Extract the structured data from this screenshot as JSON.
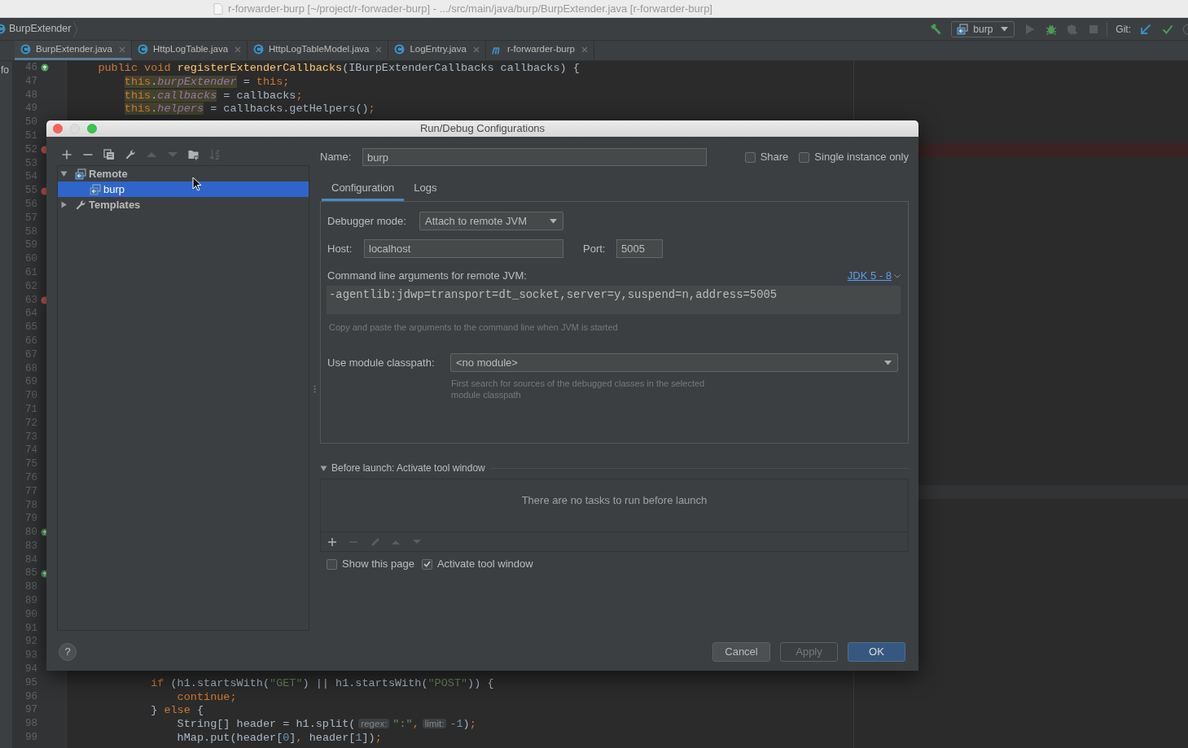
{
  "window": {
    "title": "r-forwarder-burp [~/project/r-forwader-burp] - .../src/main/java/burp/BurpExtender.java [r-forwarder-burp]"
  },
  "navigation_bar": {
    "breadcrumb": "BurpExtender",
    "run_configuration": "burp",
    "git_label": "Git:"
  },
  "editor_tabs": [
    {
      "label": "BurpExtender.java",
      "kind": "class",
      "selected": true
    },
    {
      "label": "HttpLogTable.java",
      "kind": "class",
      "selected": false
    },
    {
      "label": "HttpLogTableModel.java",
      "kind": "class",
      "selected": false
    },
    {
      "label": "LogEntry.java",
      "kind": "class",
      "selected": false
    },
    {
      "label": "r-forwarder-burp",
      "kind": "module",
      "selected": false
    }
  ],
  "side_strip": {
    "label": "fo"
  },
  "editor": {
    "lines": [
      {
        "number": "46",
        "kind": "override",
        "tokens": [
          {
            "text": "    public void ",
            "kind": "keyword"
          },
          {
            "text": "registerExtenderCallbacks",
            "kind": "method"
          },
          {
            "text": "(IBurpExtenderCallbacks callbacks) {"
          }
        ]
      },
      {
        "number": "47",
        "kind": "plain",
        "tokens": [
          {
            "text": "        this",
            "kind": "keyword",
            "highlighted": true
          },
          {
            "text": ".",
            "highlighted": true
          },
          {
            "text": "burpExtender",
            "kind": "field",
            "highlighted": true
          },
          {
            "text": " = "
          },
          {
            "text": "this;",
            "kind": "keyword"
          }
        ]
      },
      {
        "number": "48",
        "kind": "plain",
        "tokens": [
          {
            "text": "        this",
            "kind": "keyword",
            "highlighted": true
          },
          {
            "text": ".",
            "highlighted": true
          },
          {
            "text": "callbacks",
            "kind": "field",
            "highlighted": true
          },
          {
            "text": " = callbacks"
          },
          {
            "text": ";",
            "kind": "keyword"
          }
        ]
      },
      {
        "number": "49",
        "kind": "plain",
        "tokens": [
          {
            "text": "        this",
            "kind": "keyword",
            "highlighted": true
          },
          {
            "text": ".",
            "highlighted": true
          },
          {
            "text": "helpers",
            "kind": "field",
            "highlighted": true
          },
          {
            "text": " = callbacks.getHelpers()"
          },
          {
            "text": ";",
            "kind": "keyword"
          }
        ]
      },
      {
        "number": "50",
        "kind": "plain"
      },
      {
        "number": "51",
        "kind": "plain"
      },
      {
        "number": "52",
        "kind": "breakpoint",
        "error": true
      },
      {
        "number": "53",
        "kind": "plain"
      },
      {
        "number": "54",
        "kind": "plain"
      },
      {
        "number": "55",
        "kind": "breakpoint"
      },
      {
        "number": "56",
        "kind": "plain"
      },
      {
        "number": "57",
        "kind": "plain"
      },
      {
        "number": "58",
        "kind": "plain"
      },
      {
        "number": "59",
        "kind": "plain"
      },
      {
        "number": "60",
        "kind": "plain"
      },
      {
        "number": "61",
        "kind": "plain"
      },
      {
        "number": "62",
        "kind": "plain"
      },
      {
        "number": "63",
        "kind": "breakpoint"
      },
      {
        "number": "64",
        "kind": "plain"
      },
      {
        "number": "65",
        "kind": "plain"
      },
      {
        "number": "66",
        "kind": "plain"
      },
      {
        "number": "67",
        "kind": "plain"
      },
      {
        "number": "68",
        "kind": "plain"
      },
      {
        "number": "69",
        "kind": "plain"
      },
      {
        "number": "70",
        "kind": "plain"
      },
      {
        "number": "71",
        "kind": "plain"
      },
      {
        "number": "72",
        "kind": "plain"
      },
      {
        "number": "73",
        "kind": "plain"
      },
      {
        "number": "74",
        "kind": "plain"
      },
      {
        "number": "75",
        "kind": "plain"
      },
      {
        "number": "76",
        "kind": "plain"
      },
      {
        "number": "77",
        "kind": "plain",
        "highlighted": true
      },
      {
        "number": "78",
        "kind": "plain"
      },
      {
        "number": "79",
        "kind": "plain"
      },
      {
        "number": "80",
        "kind": "override"
      },
      {
        "number": "83",
        "kind": "plain"
      },
      {
        "number": "84",
        "kind": "plain"
      },
      {
        "number": "85",
        "kind": "override"
      },
      {
        "number": "88",
        "kind": "plain"
      },
      {
        "number": "89",
        "kind": "plain"
      },
      {
        "number": "90",
        "kind": "plain"
      },
      {
        "number": "91",
        "kind": "plain"
      },
      {
        "number": "92",
        "kind": "plain"
      },
      {
        "number": "93",
        "kind": "plain"
      },
      {
        "number": "94",
        "kind": "plain"
      },
      {
        "number": "95",
        "kind": "plain",
        "tokens": [
          {
            "text": "            if",
            "kind": "keyword"
          },
          {
            "text": " (h1.startsWith("
          },
          {
            "text": "\"GET\"",
            "kind": "string"
          },
          {
            "text": ") || h1.startsWith("
          },
          {
            "text": "\"POST\"",
            "kind": "string"
          },
          {
            "text": ")) {"
          }
        ]
      },
      {
        "number": "96",
        "kind": "plain",
        "tokens": [
          {
            "text": "                continue;",
            "kind": "keyword"
          }
        ]
      },
      {
        "number": "97",
        "kind": "plain",
        "tokens": [
          {
            "text": "            } "
          },
          {
            "text": "else",
            "kind": "keyword"
          },
          {
            "text": " {"
          }
        ]
      },
      {
        "number": "98",
        "kind": "plain",
        "tokens": [
          {
            "text": "                String[] header = h1.split("
          },
          {
            "text": "regex:",
            "kind": "hint"
          },
          {
            "text": "\":\"",
            "kind": "string"
          },
          {
            "text": ",",
            "kind": "keyword"
          },
          {
            "text": "limit:",
            "kind": "hint"
          },
          {
            "text": "-1",
            "kind": "number"
          },
          {
            "text": ")"
          },
          {
            "text": ";",
            "kind": "keyword"
          }
        ]
      },
      {
        "number": "99",
        "kind": "plain",
        "tokens": [
          {
            "text": "                hMap.put(header["
          },
          {
            "text": "0",
            "kind": "number"
          },
          {
            "text": "]"
          },
          {
            "text": ",",
            "kind": "keyword"
          },
          {
            "text": " header["
          },
          {
            "text": "1",
            "kind": "number"
          },
          {
            "text": "])"
          },
          {
            "text": ";",
            "kind": "keyword"
          }
        ]
      }
    ]
  },
  "dialog": {
    "title": "Run/Debug Configurations",
    "tree": [
      {
        "label": "Remote",
        "kind": "remote",
        "expanded": true,
        "selected": false,
        "children": [
          {
            "label": "burp",
            "kind": "remote",
            "selected": true
          }
        ]
      },
      {
        "label": "Templates",
        "kind": "templates",
        "expanded": false,
        "selected": false
      }
    ],
    "help_button": "?",
    "name": {
      "label": "Name:",
      "value": "burp"
    },
    "options": [
      {
        "label": "Share",
        "checked": false
      },
      {
        "label": "Single instance only",
        "checked": false
      }
    ],
    "tabs": [
      {
        "label": "Configuration",
        "selected": true
      },
      {
        "label": "Logs",
        "selected": false
      }
    ],
    "debugger_mode": {
      "label": "Debugger mode:",
      "value": "Attach to remote JVM"
    },
    "host": {
      "label": "Host:",
      "value": "localhost"
    },
    "port": {
      "label": "Port:",
      "value": "5005"
    },
    "command_line": {
      "label": "Command line arguments for remote JVM:",
      "jdk_link": "JDK 5 - 8",
      "value": "-agentlib:jdwp=transport=dt_socket,server=y,suspend=n,address=5005",
      "hint": "Copy and paste the arguments to the command line when JVM is started"
    },
    "module_classpath": {
      "label": "Use module classpath:",
      "value": "<no module>",
      "hint": "First search for sources of the debugged classes in the selected module classpath"
    },
    "before_launch": {
      "title": "Before launch: Activate tool window",
      "expanded": true,
      "empty_text": "There are no tasks to run before launch"
    },
    "launch_options": [
      {
        "label": "Show this page",
        "checked": false
      },
      {
        "label": "Activate tool window",
        "checked": true
      }
    ],
    "buttons": [
      {
        "label": "Cancel",
        "kind": "default"
      },
      {
        "label": "Apply",
        "kind": "disabled"
      },
      {
        "label": "OK",
        "kind": "primary"
      }
    ]
  }
}
